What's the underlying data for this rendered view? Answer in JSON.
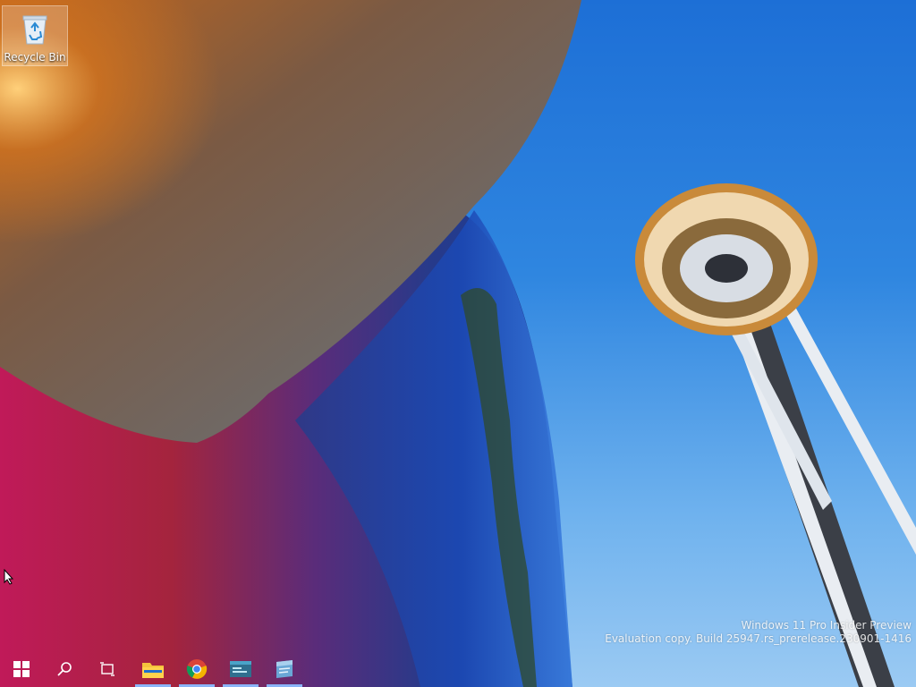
{
  "desktop": {
    "icons": [
      {
        "label": "Recycle Bin",
        "icon": "recycle-bin-icon"
      }
    ],
    "watermark": {
      "line1": "Windows 11 Pro Insider Preview",
      "line2": "Evaluation copy. Build 25947.rs_prerelease.230901-1416"
    }
  },
  "taskbar": {
    "items": [
      {
        "name": "start",
        "icon": "windows-logo-icon",
        "running": false
      },
      {
        "name": "search",
        "icon": "search-icon",
        "running": false
      },
      {
        "name": "task-view",
        "icon": "task-view-icon",
        "running": false
      },
      {
        "name": "file-explorer",
        "icon": "folder-icon",
        "running": true
      },
      {
        "name": "chrome",
        "icon": "chrome-icon",
        "running": true
      },
      {
        "name": "terminal",
        "icon": "terminal-icon",
        "running": true
      },
      {
        "name": "app",
        "icon": "app-window-icon",
        "running": true
      }
    ]
  },
  "colors": {
    "sky": "#2f86e0",
    "accent_indicator": "#8ab4f8"
  }
}
